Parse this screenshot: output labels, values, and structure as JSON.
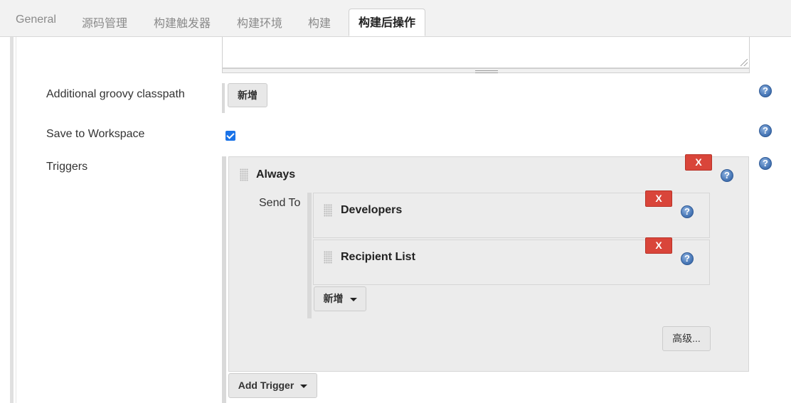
{
  "tabs": [
    {
      "label": "General"
    },
    {
      "label": "源码管理"
    },
    {
      "label": "构建触发器"
    },
    {
      "label": "构建环境"
    },
    {
      "label": "构建"
    },
    {
      "label": "构建后操作"
    }
  ],
  "active_tab": "构建后操作",
  "fields": {
    "additional_classpath": {
      "label": "Additional groovy classpath",
      "add_button": "新增"
    },
    "save_to_workspace": {
      "label": "Save to Workspace",
      "checked": true
    },
    "triggers": {
      "label": "Triggers"
    }
  },
  "trigger": {
    "title": "Always",
    "delete_label": "X",
    "send_to_label": "Send To",
    "recipients": [
      {
        "title": "Developers",
        "delete_label": "X"
      },
      {
        "title": "Recipient List",
        "delete_label": "X"
      }
    ],
    "add_recipient_button": "新增",
    "advanced_button": "高级..."
  },
  "add_trigger_button": "Add Trigger",
  "help_glyph": "?",
  "icons": {
    "help": "help-icon",
    "drag": "drag-handle-icon",
    "dropdown": "caret-down-icon",
    "check": "checkbox-checked-icon"
  },
  "colors": {
    "delete_button": "#d9453a",
    "help_icon": "#4a79b8",
    "checkbox": "#1a73e8"
  }
}
